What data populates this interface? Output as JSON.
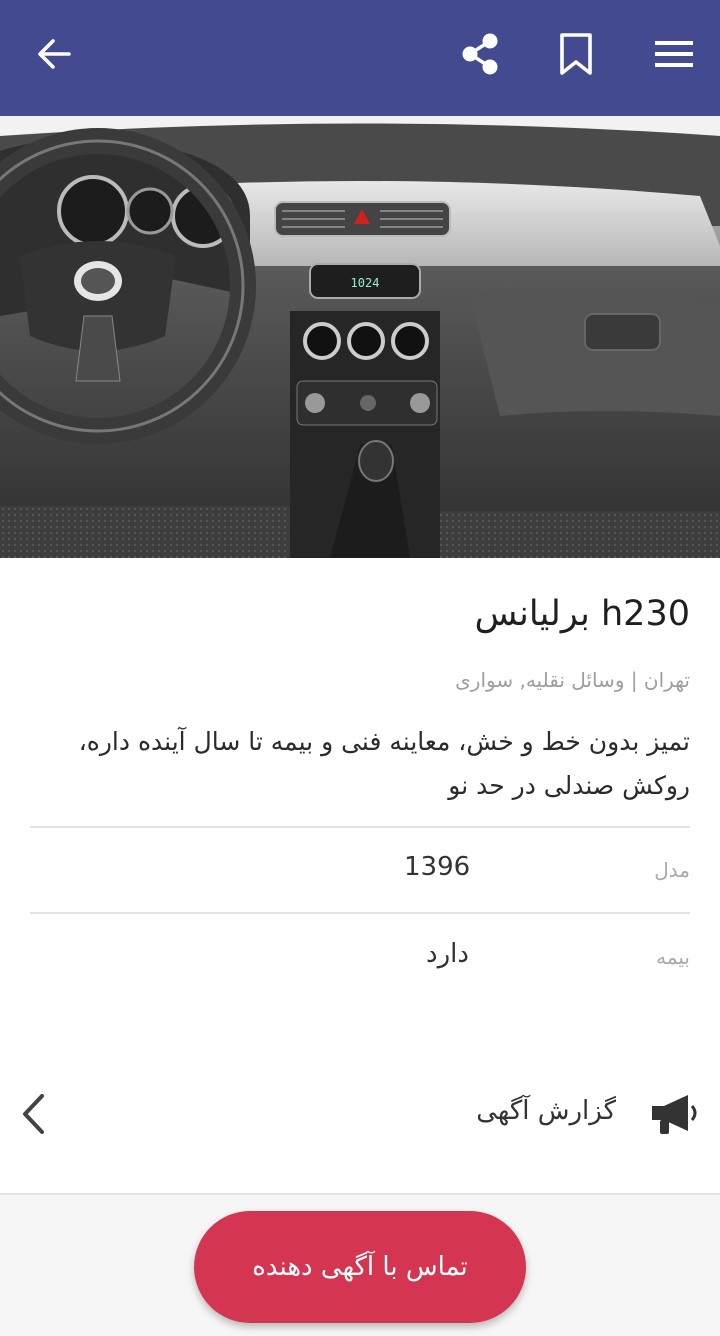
{
  "appbar": {
    "background": "#434a8f",
    "icons": [
      "back-arrow-icon",
      "share-icon",
      "bookmark-icon",
      "hamburger-menu-icon"
    ]
  },
  "listing": {
    "title": "برلیانس h230",
    "meta": "تهران | وسائل نقلیه, سواری",
    "description": "تمیز بدون خط و خش، معاینه فنی و بیمه تا سال آینده داره، روکش صندلی در حد نو"
  },
  "details": [
    {
      "label": "مدل",
      "value": "1396"
    },
    {
      "label": "بیمه",
      "value": "دارد"
    }
  ],
  "report": {
    "label": "گزارش آگهی",
    "icon": "megaphone-icon",
    "chevron": "chevron-left-icon"
  },
  "cta": {
    "label": "تماس با آگهی دهنده",
    "color": "#d43551"
  },
  "hero": {
    "icon": "car-interior-photo",
    "dashboard_display": "1024"
  }
}
